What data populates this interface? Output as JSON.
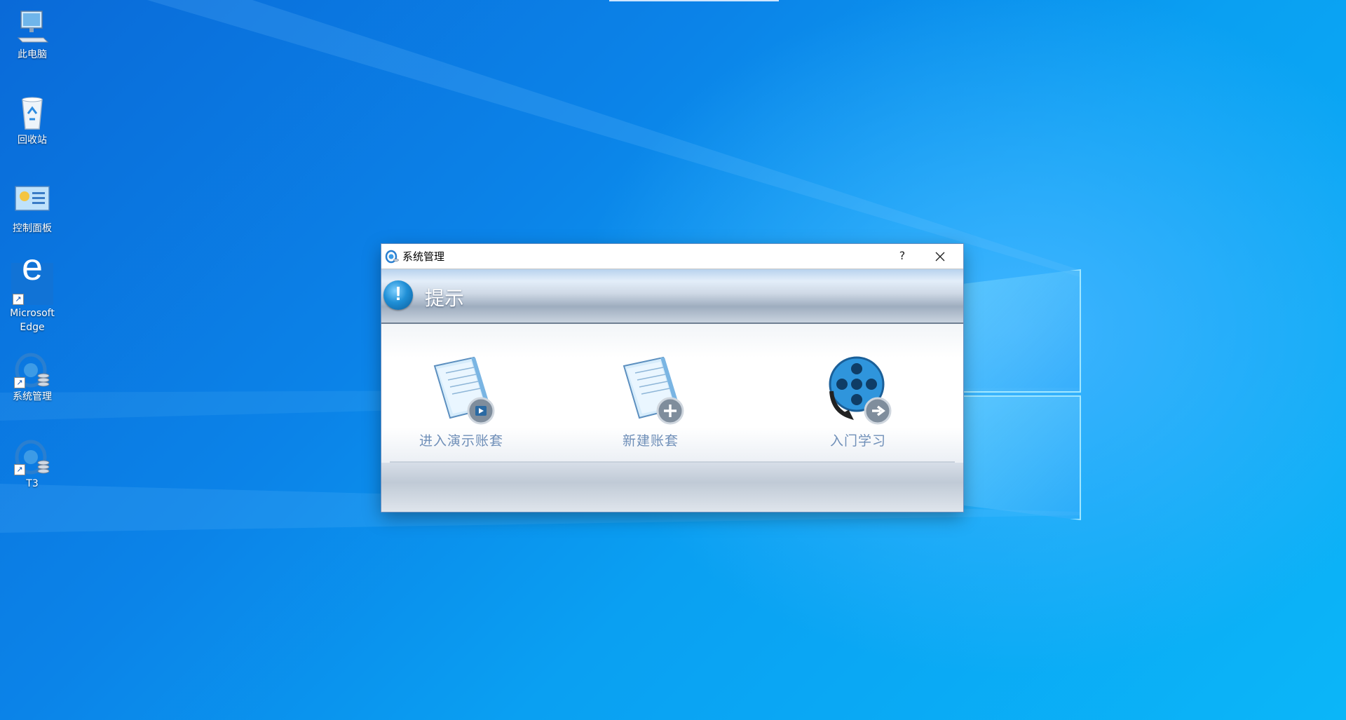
{
  "desktop": {
    "icons": [
      {
        "label": "此电脑"
      },
      {
        "label": "回收站"
      },
      {
        "label": "控制面板"
      },
      {
        "label": "Microsoft Edge"
      },
      {
        "label": "系统管理"
      },
      {
        "label": "T3"
      }
    ]
  },
  "dialog": {
    "title": "系统管理",
    "help_label": "?",
    "header_title": "提示",
    "actions": [
      {
        "label": "进入演示账套",
        "icon": "notebook-play-icon"
      },
      {
        "label": "新建账套",
        "icon": "notebook-add-icon"
      },
      {
        "label": "入门学习",
        "icon": "film-reel-icon"
      }
    ]
  },
  "colors": {
    "desktop_blue": "#0b83e8",
    "action_text": "#6f8fb8"
  }
}
